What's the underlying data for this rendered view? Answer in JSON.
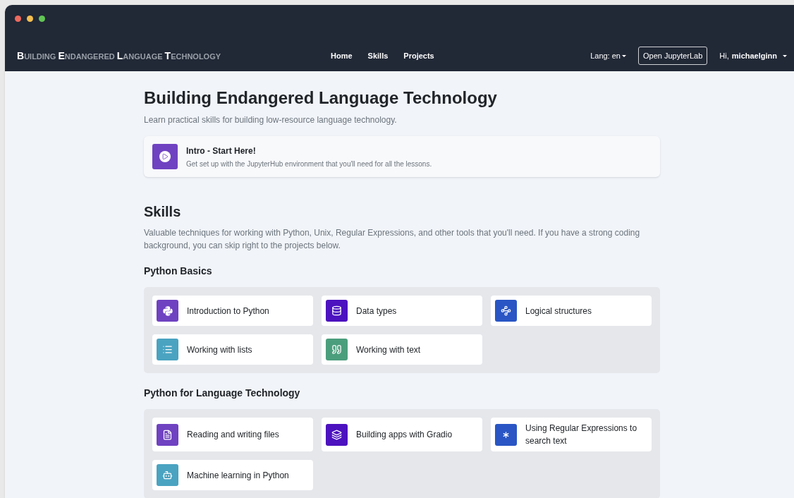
{
  "window": {
    "controls": [
      {
        "color": "#ed6a5e"
      },
      {
        "color": "#f5bf4f"
      },
      {
        "color": "#61c554"
      }
    ]
  },
  "navbar": {
    "brand": [
      "BUILDING",
      "ENDANGERED",
      "LANGUAGE",
      "TECHNOLOGY"
    ],
    "links": [
      "Home",
      "Skills",
      "Projects"
    ],
    "language": "Lang: en",
    "jupyter_button": "Open JupyterLab",
    "greeting": "Hi,",
    "user": "michaelginn"
  },
  "header": {
    "title": "Building Endangered Language Technology",
    "subtitle": "Learn practical skills for building low-resource language technology."
  },
  "intro": {
    "title": "Intro - Start Here!",
    "description": "Get set up with the JupyterHub environment that you'll need for all the lessons.",
    "color": "#6f42c1"
  },
  "skills": {
    "title": "Skills",
    "description": "Valuable techniques for working with Python, Unix, Regular Expressions, and other tools that you'll need. If you have a strong coding background, you can skip right to the projects below.",
    "groups": [
      {
        "title": "Python Basics",
        "items": [
          {
            "label": "Introduction to Python",
            "color": "#6f42c1"
          },
          {
            "label": "Data types",
            "color": "#4c12bf"
          },
          {
            "label": "Logical structures",
            "color": "#2956c4"
          },
          {
            "label": "Working with lists",
            "color": "#4aa3c1"
          },
          {
            "label": "Working with text",
            "color": "#4b9e7c"
          }
        ]
      },
      {
        "title": "Python for Language Technology",
        "items": [
          {
            "label": "Reading and writing files",
            "color": "#6f42c1"
          },
          {
            "label": "Building apps with Gradio",
            "color": "#4c12bf"
          },
          {
            "label": "Using Regular Expressions to search text",
            "color": "#2956c4"
          },
          {
            "label": "Machine learning in Python",
            "color": "#4aa3c1"
          }
        ]
      }
    ]
  }
}
